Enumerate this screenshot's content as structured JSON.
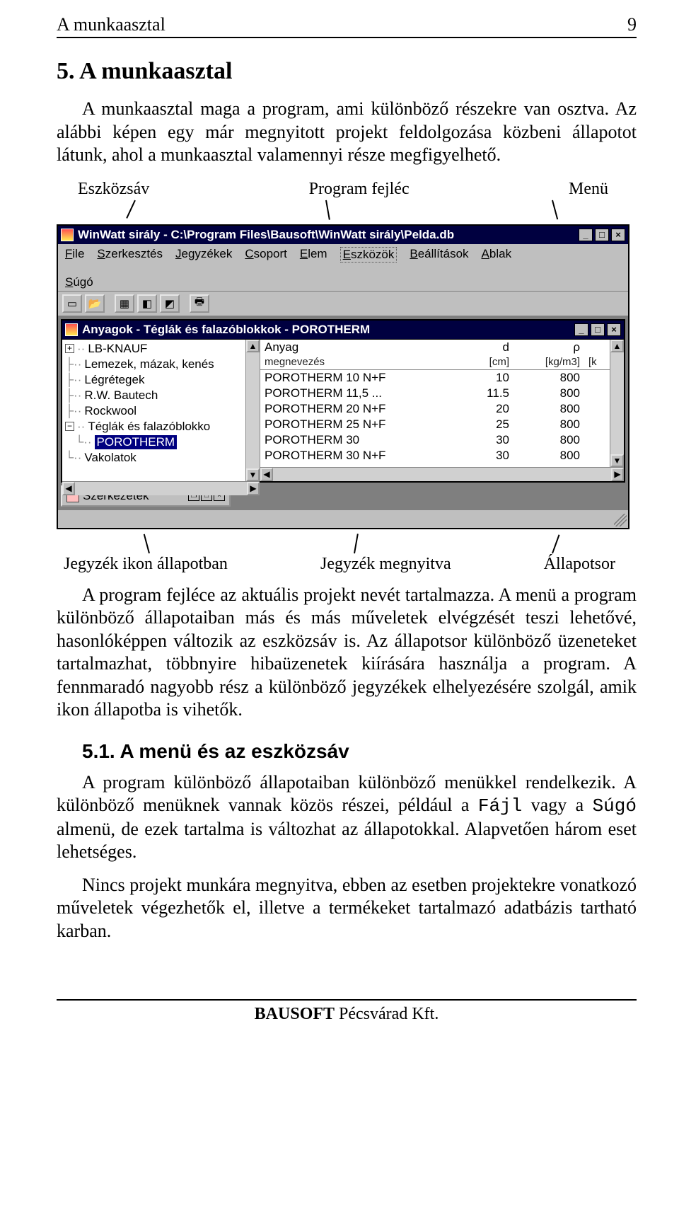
{
  "header": {
    "left": "A munkaasztal",
    "right": "9"
  },
  "section_title": "5.  A munkaasztal",
  "para1": "A munkaasztal maga a program, ami különböző részekre van osztva. Az alábbi képen egy már megnyitott projekt feldolgozása közbeni állapotot látunk, ahol a munkaasztal valamennyi része megfigyelhető.",
  "callouts_top": {
    "a": "Eszközsáv",
    "b": "Program fejléc",
    "c": "Menü"
  },
  "callouts_bottom": {
    "a": "Jegyzék ikon állapotban",
    "b": "Jegyzék megnyitva",
    "c": "Állapotsor"
  },
  "app": {
    "title": "WinWatt sirály - C:\\Program Files\\Bausoft\\WinWatt sirály\\Pelda.db",
    "menu": [
      "File",
      "Szerkesztés",
      "Jegyzékek",
      "Csoport",
      "Elem",
      "Eszközök",
      "Beállítások",
      "Ablak",
      "Súgó"
    ],
    "child_title": "Anyagok - Téglák és falazóblokkok - POROTHERM",
    "tree": [
      {
        "box": "+",
        "label": "LB-KNAUF",
        "indent": 0
      },
      {
        "box": "",
        "label": "Lemezek, mázak, kenés",
        "indent": 0
      },
      {
        "box": "",
        "label": "Légrétegek",
        "indent": 0
      },
      {
        "box": "",
        "label": "R.W. Bautech",
        "indent": 0
      },
      {
        "box": "",
        "label": "Rockwool",
        "indent": 0
      },
      {
        "box": "-",
        "label": "Téglák és falazóblokko",
        "indent": 0
      },
      {
        "box": "",
        "label": "POROTHERM",
        "indent": 1,
        "selected": true
      },
      {
        "box": "",
        "label": "Vakolatok",
        "indent": 0
      }
    ],
    "grid_head": {
      "c1a": "Anyag",
      "c1b": "megnevezés",
      "c2a": "d",
      "c2b": "[cm]",
      "c3a": "ρ",
      "c3b": "[kg/m3]",
      "c4": "[k"
    },
    "grid_rows": [
      {
        "name": "POROTHERM 10 N+F",
        "d": "10",
        "rho": "800"
      },
      {
        "name": "POROTHERM 11,5 ...",
        "d": "11.5",
        "rho": "800"
      },
      {
        "name": "POROTHERM 20 N+F",
        "d": "20",
        "rho": "800"
      },
      {
        "name": "POROTHERM 25 N+F",
        "d": "25",
        "rho": "800"
      },
      {
        "name": "POROTHERM 30",
        "d": "30",
        "rho": "800"
      },
      {
        "name": "POROTHERM 30 N+F",
        "d": "30",
        "rho": "800"
      }
    ],
    "minimized": "Szerkezetek"
  },
  "para2_a": "A program fejléce az aktuális projekt nevét tartalmazza. A menü a program különböző állapotaiban más és más műveletek elvégzését teszi lehetővé, hasonlóképpen változik az eszközsáv is. Az állapotsor különböző üzeneteket tartalmazhat, többnyire hibaüzenetek kiírására használja a program. A fennmaradó nagyobb rész a különböző jegyzékek elhelyezésére szolgál, amik ikon állapotba is vihetők.",
  "h2": "5.1.   A menü és az eszközsáv",
  "para3_pre": "A program különböző állapotaiban különböző menükkel rendelkezik. A különböző menüknek vannak közös részei, például a ",
  "para3_code1": "Fájl",
  "para3_mid": " vagy a ",
  "para3_code2": "Súgó",
  "para3_post": " almenü, de ezek tartalma is változhat az állapotokkal. Alapvetően három eset lehetséges.",
  "para4": "Nincs projekt munkára megnyitva, ebben az esetben projektekre vonatkozó műveletek végezhetők el, illetve a termékeket tartalmazó adatbázis tartható karban.",
  "footer": {
    "brand": "BAUSOFT",
    "rest": " Pécsvárad Kft."
  }
}
